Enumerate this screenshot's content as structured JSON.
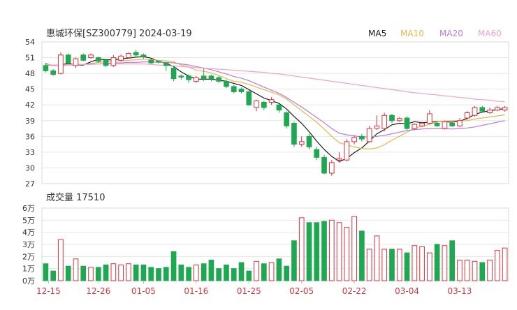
{
  "header": {
    "title": "惠城环保[SZ300779] 2024-03-19",
    "legend": [
      {
        "label": "MA5",
        "color": "#1a1a1a"
      },
      {
        "label": "MA10",
        "color": "#f0b44c"
      },
      {
        "label": "MA20",
        "color": "#b87be0"
      },
      {
        "label": "MA60",
        "color": "#f0a2d0"
      }
    ]
  },
  "volume_header": {
    "label": "成交量 17510"
  },
  "colors": {
    "up": "#e0303c",
    "down": "#1fa851",
    "grid": "#e6e6e6",
    "axis_text": "#333333",
    "date_text": "#e0303c"
  },
  "chart_data": [
    {
      "type": "candlestick",
      "ylim": [
        27,
        54
      ],
      "y_ticks": [
        "54",
        "51",
        "48",
        "45",
        "42",
        "39",
        "36",
        "33",
        "30",
        "27"
      ],
      "candles": [
        [
          49.5,
          48.5,
          50.0,
          48.2
        ],
        [
          48.5,
          47.8,
          48.8,
          47.5
        ],
        [
          48.0,
          51.5,
          52.0,
          47.8
        ],
        [
          51.5,
          50.0,
          51.8,
          49.8
        ],
        [
          49.5,
          50.8,
          51.0,
          49.0
        ],
        [
          51.5,
          50.5,
          51.8,
          50.3
        ],
        [
          51.0,
          51.5,
          51.8,
          50.8
        ],
        [
          51.0,
          50.3,
          51.2,
          50.0
        ],
        [
          50.5,
          49.5,
          50.8,
          49.2
        ],
        [
          49.5,
          51.0,
          51.5,
          49.2
        ],
        [
          50.5,
          51.3,
          51.6,
          50.3
        ],
        [
          51.0,
          51.8,
          52.0,
          50.8
        ],
        [
          52.0,
          51.5,
          52.5,
          51.0
        ],
        [
          51.5,
          51.2,
          51.8,
          50.8
        ],
        [
          50.5,
          50.0,
          50.8,
          49.8
        ],
        [
          50.3,
          50.2,
          50.5,
          49.9
        ],
        [
          50.0,
          49.5,
          50.2,
          48.5
        ],
        [
          49.0,
          47.0,
          49.5,
          46.5
        ],
        [
          47.5,
          47.3,
          47.8,
          46.8
        ],
        [
          47.5,
          46.8,
          47.8,
          46.2
        ],
        [
          46.5,
          47.2,
          47.5,
          46.2
        ],
        [
          47.5,
          47.0,
          49.0,
          46.5
        ],
        [
          47.5,
          47.0,
          47.8,
          46.5
        ],
        [
          47.2,
          46.5,
          47.5,
          46.2
        ],
        [
          46.5,
          45.5,
          46.8,
          45.2
        ],
        [
          45.5,
          44.5,
          45.8,
          44.2
        ],
        [
          45.0,
          44.5,
          45.3,
          44.2
        ],
        [
          44.5,
          42.0,
          44.8,
          41.8
        ],
        [
          41.5,
          42.8,
          43.0,
          40.8
        ],
        [
          42.5,
          41.5,
          42.8,
          41.0
        ],
        [
          42.5,
          43.0,
          43.5,
          42.0
        ],
        [
          42.0,
          41.0,
          42.2,
          40.5
        ],
        [
          40.5,
          38.0,
          40.8,
          37.5
        ],
        [
          38.5,
          34.5,
          38.8,
          34.0
        ],
        [
          34.5,
          35.0,
          36.0,
          34.0
        ],
        [
          36.0,
          34.0,
          36.5,
          33.5
        ],
        [
          33.5,
          32.0,
          34.0,
          31.5
        ],
        [
          32.0,
          29.0,
          32.5,
          28.8
        ],
        [
          29.0,
          31.0,
          31.5,
          28.5
        ],
        [
          31.5,
          31.8,
          33.0,
          31.0
        ],
        [
          31.5,
          35.0,
          35.5,
          31.2
        ],
        [
          35.0,
          35.8,
          36.2,
          34.5
        ],
        [
          36.0,
          35.5,
          36.5,
          35.0
        ],
        [
          35.0,
          37.5,
          38.0,
          34.8
        ],
        [
          37.5,
          38.0,
          40.0,
          37.2
        ],
        [
          37.5,
          40.0,
          40.5,
          37.0
        ],
        [
          40.0,
          39.0,
          40.3,
          38.5
        ],
        [
          39.0,
          39.4,
          39.7,
          38.8
        ],
        [
          39.5,
          37.5,
          39.8,
          37.2
        ],
        [
          37.5,
          38.3,
          38.5,
          37.2
        ],
        [
          38.0,
          38.5,
          38.8,
          37.8
        ],
        [
          38.5,
          40.3,
          41.0,
          38.3
        ],
        [
          38.5,
          38.0,
          38.8,
          37.8
        ],
        [
          37.5,
          38.8,
          39.0,
          37.3
        ],
        [
          38.5,
          38.0,
          38.8,
          37.8
        ],
        [
          38.0,
          39.0,
          39.5,
          37.8
        ],
        [
          39.5,
          40.5,
          40.8,
          39.2
        ],
        [
          40.0,
          41.5,
          41.8,
          39.8
        ],
        [
          41.5,
          40.8,
          41.8,
          40.5
        ],
        [
          40.5,
          41.0,
          41.5,
          40.3
        ],
        [
          41.0,
          41.5,
          41.8,
          40.8
        ],
        [
          41.0,
          41.5,
          41.8,
          40.7
        ]
      ],
      "ma_series": [
        {
          "name": "MA5",
          "values": [
            49.8,
            49.5,
            49.6,
            49.9,
            49.6,
            49.6,
            50.2,
            50.7,
            50.6,
            50.6,
            50.8,
            50.9,
            51.1,
            51.2,
            50.9,
            50.3,
            49.9,
            49.3,
            48.3,
            47.5,
            46.9,
            46.9,
            46.9,
            46.7,
            46.5,
            46.1,
            45.7,
            44.9,
            44.1,
            43.3,
            42.8,
            42.3,
            41.2,
            39.8,
            38.5,
            36.9,
            35.1,
            33.5,
            32.2,
            31.2,
            31.8,
            32.9,
            33.8,
            35.1,
            36.5,
            37.3,
            38.2,
            38.5,
            38.4,
            38.8,
            38.6,
            38.7,
            38.8,
            38.8,
            38.7,
            38.9,
            39.4,
            40.2,
            40.6,
            40.9,
            41.1,
            41.3
          ]
        },
        {
          "name": "MA10",
          "values": [
            49.7,
            49.6,
            49.6,
            49.7,
            49.7,
            49.7,
            49.9,
            50.1,
            50.2,
            50.3,
            50.4,
            50.5,
            50.6,
            50.7,
            50.6,
            50.5,
            50.4,
            50.2,
            49.6,
            49.2,
            48.6,
            48.4,
            48.1,
            47.6,
            47.0,
            46.5,
            46.3,
            45.9,
            45.4,
            44.9,
            44.4,
            43.9,
            43.1,
            42.0,
            40.9,
            39.8,
            38.7,
            37.4,
            36.0,
            34.8,
            34.4,
            34.0,
            33.7,
            33.6,
            33.8,
            34.4,
            35.3,
            36.0,
            36.8,
            37.6,
            37.9,
            38.3,
            38.7,
            38.9,
            39.0,
            39.0,
            39.0,
            39.3,
            39.5,
            39.7,
            39.9,
            40.1
          ]
        },
        {
          "name": "MA20",
          "values": [
            49.5,
            49.5,
            49.5,
            49.6,
            49.6,
            49.7,
            49.8,
            49.8,
            49.9,
            50.0,
            50.0,
            50.1,
            50.1,
            50.2,
            50.2,
            50.1,
            50.1,
            50.0,
            49.8,
            49.6,
            49.3,
            49.0,
            48.7,
            48.3,
            47.9,
            47.4,
            47.1,
            46.6,
            46.0,
            45.4,
            44.8,
            44.2,
            43.4,
            42.5,
            41.6,
            40.6,
            39.6,
            38.6,
            37.5,
            36.6,
            36.3,
            36.1,
            35.9,
            35.9,
            36.0,
            36.2,
            36.5,
            36.8,
            37.1,
            37.3,
            37.4,
            37.5,
            37.5,
            37.5,
            37.4,
            37.5,
            37.6,
            37.8,
            38.1,
            38.4,
            38.7,
            39.0
          ]
        },
        {
          "name": "MA60",
          "values": [
            49.5,
            49.6,
            49.6,
            49.6,
            49.7,
            49.7,
            49.7,
            49.8,
            49.8,
            49.8,
            49.8,
            49.8,
            49.8,
            49.8,
            49.7,
            49.6,
            49.5,
            49.4,
            49.3,
            49.2,
            49.1,
            49.0,
            48.9,
            48.8,
            48.7,
            48.6,
            48.5,
            48.4,
            48.3,
            48.2,
            48.0,
            47.9,
            47.7,
            47.5,
            47.3,
            47.1,
            46.9,
            46.7,
            46.5,
            46.3,
            46.1,
            45.9,
            45.7,
            45.5,
            45.3,
            45.1,
            44.9,
            44.7,
            44.5,
            44.3,
            44.2,
            44.0,
            43.9,
            43.7,
            43.6,
            43.4,
            43.3,
            43.1,
            43.0,
            42.9,
            42.7,
            42.6
          ]
        }
      ]
    },
    {
      "type": "bar",
      "unit": "万",
      "ylim": [
        0,
        6
      ],
      "y_ticks": [
        "6万",
        "5万",
        "4万",
        "3万",
        "2万",
        "1万",
        "0万"
      ],
      "values": [
        1.4,
        0.8,
        3.4,
        1.2,
        1.8,
        1.2,
        1.1,
        1.1,
        1.3,
        1.4,
        1.3,
        1.4,
        1.3,
        1.3,
        1.1,
        1.0,
        1.1,
        2.4,
        1.3,
        1.1,
        1.3,
        1.4,
        1.7,
        1.0,
        1.3,
        1.0,
        1.5,
        0.8,
        1.6,
        1.4,
        1.5,
        1.8,
        1.2,
        3.3,
        5.2,
        4.8,
        4.8,
        4.9,
        5.0,
        4.8,
        4.4,
        5.3,
        4.1,
        2.6,
        3.7,
        2.6,
        2.6,
        2.6,
        2.3,
        2.9,
        2.8,
        2.3,
        3.0,
        2.9,
        3.3,
        1.7,
        1.7,
        1.6,
        1.5,
        1.7,
        2.5,
        2.7
      ]
    }
  ],
  "x_axis": {
    "labels": [
      "12-15",
      "12-26",
      "01-05",
      "01-16",
      "01-25",
      "02-05",
      "02-22",
      "03-04",
      "03-13"
    ]
  }
}
